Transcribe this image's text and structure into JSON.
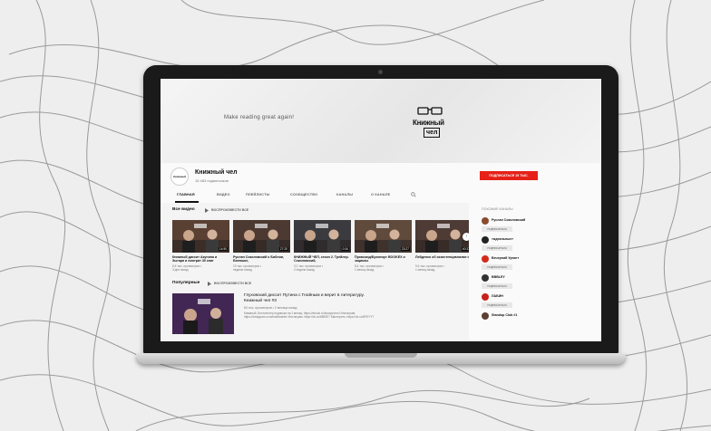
{
  "banner": {
    "tagline": "Make reading great again!",
    "logo_line1": "Книжный",
    "logo_line2": "чел"
  },
  "channel": {
    "avatar_text": "Книжный чел",
    "name": "Книжный чел",
    "subscribers": "15 483 подписчиков",
    "subscribe_label": "ПОДПИСАТЬСЯ 15 ТЫС."
  },
  "tabs": [
    "ГЛАВНАЯ",
    "ВИДЕО",
    "ПЛЕЙЛИСТЫ",
    "СООБЩЕСТВО",
    "КАНАЛЫ",
    "О КАНАЛЕ"
  ],
  "uploads": {
    "title": "Все видео",
    "play_all": "ВОСПРОИЗВЕСТИ ВСЕ",
    "videos": [
      {
        "title": "Книжный дисcит Акунина и Зыгаря и смотрит 30 книг",
        "meta1": "6,6 тыс. просмотров •",
        "meta2": "3 дня назад",
        "duration": "14:50",
        "color": "#5a3f33"
      },
      {
        "title": "Руслан Соколовский о Библии, Батюшке,",
        "meta1": "19 тыс. просмотров •",
        "meta2": "неделю назад",
        "duration": "27:20",
        "color": "#4c3a32"
      },
      {
        "title": "КНИЖНЫЙ ЧЕЛ, сезон 2. Трейлер. Соколовский,",
        "meta1": "3,2 тыс. просмотров •",
        "meta2": "2 недели назад",
        "duration": "0:34",
        "color": "#3b3b3f"
      },
      {
        "title": "Промокод/Бронеорг BOOKEX и зациклы",
        "meta1": "8,4 тыс. просмотров •",
        "meta2": "1 месяц назад",
        "duration": "23:27",
        "color": "#5f4a3c"
      },
      {
        "title": "Лейденко об экзистенциализме и",
        "meta1": "9,6 тыс. просмотров •",
        "meta2": "1 месяц назад",
        "duration": "40:37",
        "color": "#4e3b35"
      }
    ]
  },
  "popular": {
    "title": "Популярные",
    "play_all": "ВОСПРОИЗВЕСТИ ВСЕ",
    "video_title": "Глуховский дисcит Путина с Гнойным и верит в литературу.",
    "video_title2": "Книжный чел #3",
    "meta": "84 тыс. просмотров • 2 месяца назад",
    "description": "Книжный. Бестселлер подписка на 1 месяц: https://ebook.ru/bookpromo! Инстаграм: https://instagram.com/mathweider Инстаграм: https://vk.cc/8890E7 Мастерить: https://vk.cc/8FEYYT"
  },
  "sidebar": {
    "title": "ПОХОЖИЕ КАНАЛЫ",
    "items": [
      {
        "name": "Руслан Соколовский",
        "button": "ПОДПИСАТЬСЯ",
        "color": "#8a4b2e"
      },
      {
        "name": "«идеальные»",
        "button": "ПОДПИСАТЬСЯ",
        "color": "#222222"
      },
      {
        "name": "Вечерний Ургант",
        "button": "ПОДПИСАТЬСЯ",
        "color": "#d42a1c"
      },
      {
        "name": "BBBLEY",
        "button": "ПОДПИСАТЬСЯ",
        "color": "#333333"
      },
      {
        "name": "ЛАБИН",
        "button": "ПОДПИСАТЬСЯ",
        "color": "#c8221a"
      },
      {
        "name": "Standup Club #1",
        "button": "",
        "color": "#5b4032"
      }
    ]
  }
}
